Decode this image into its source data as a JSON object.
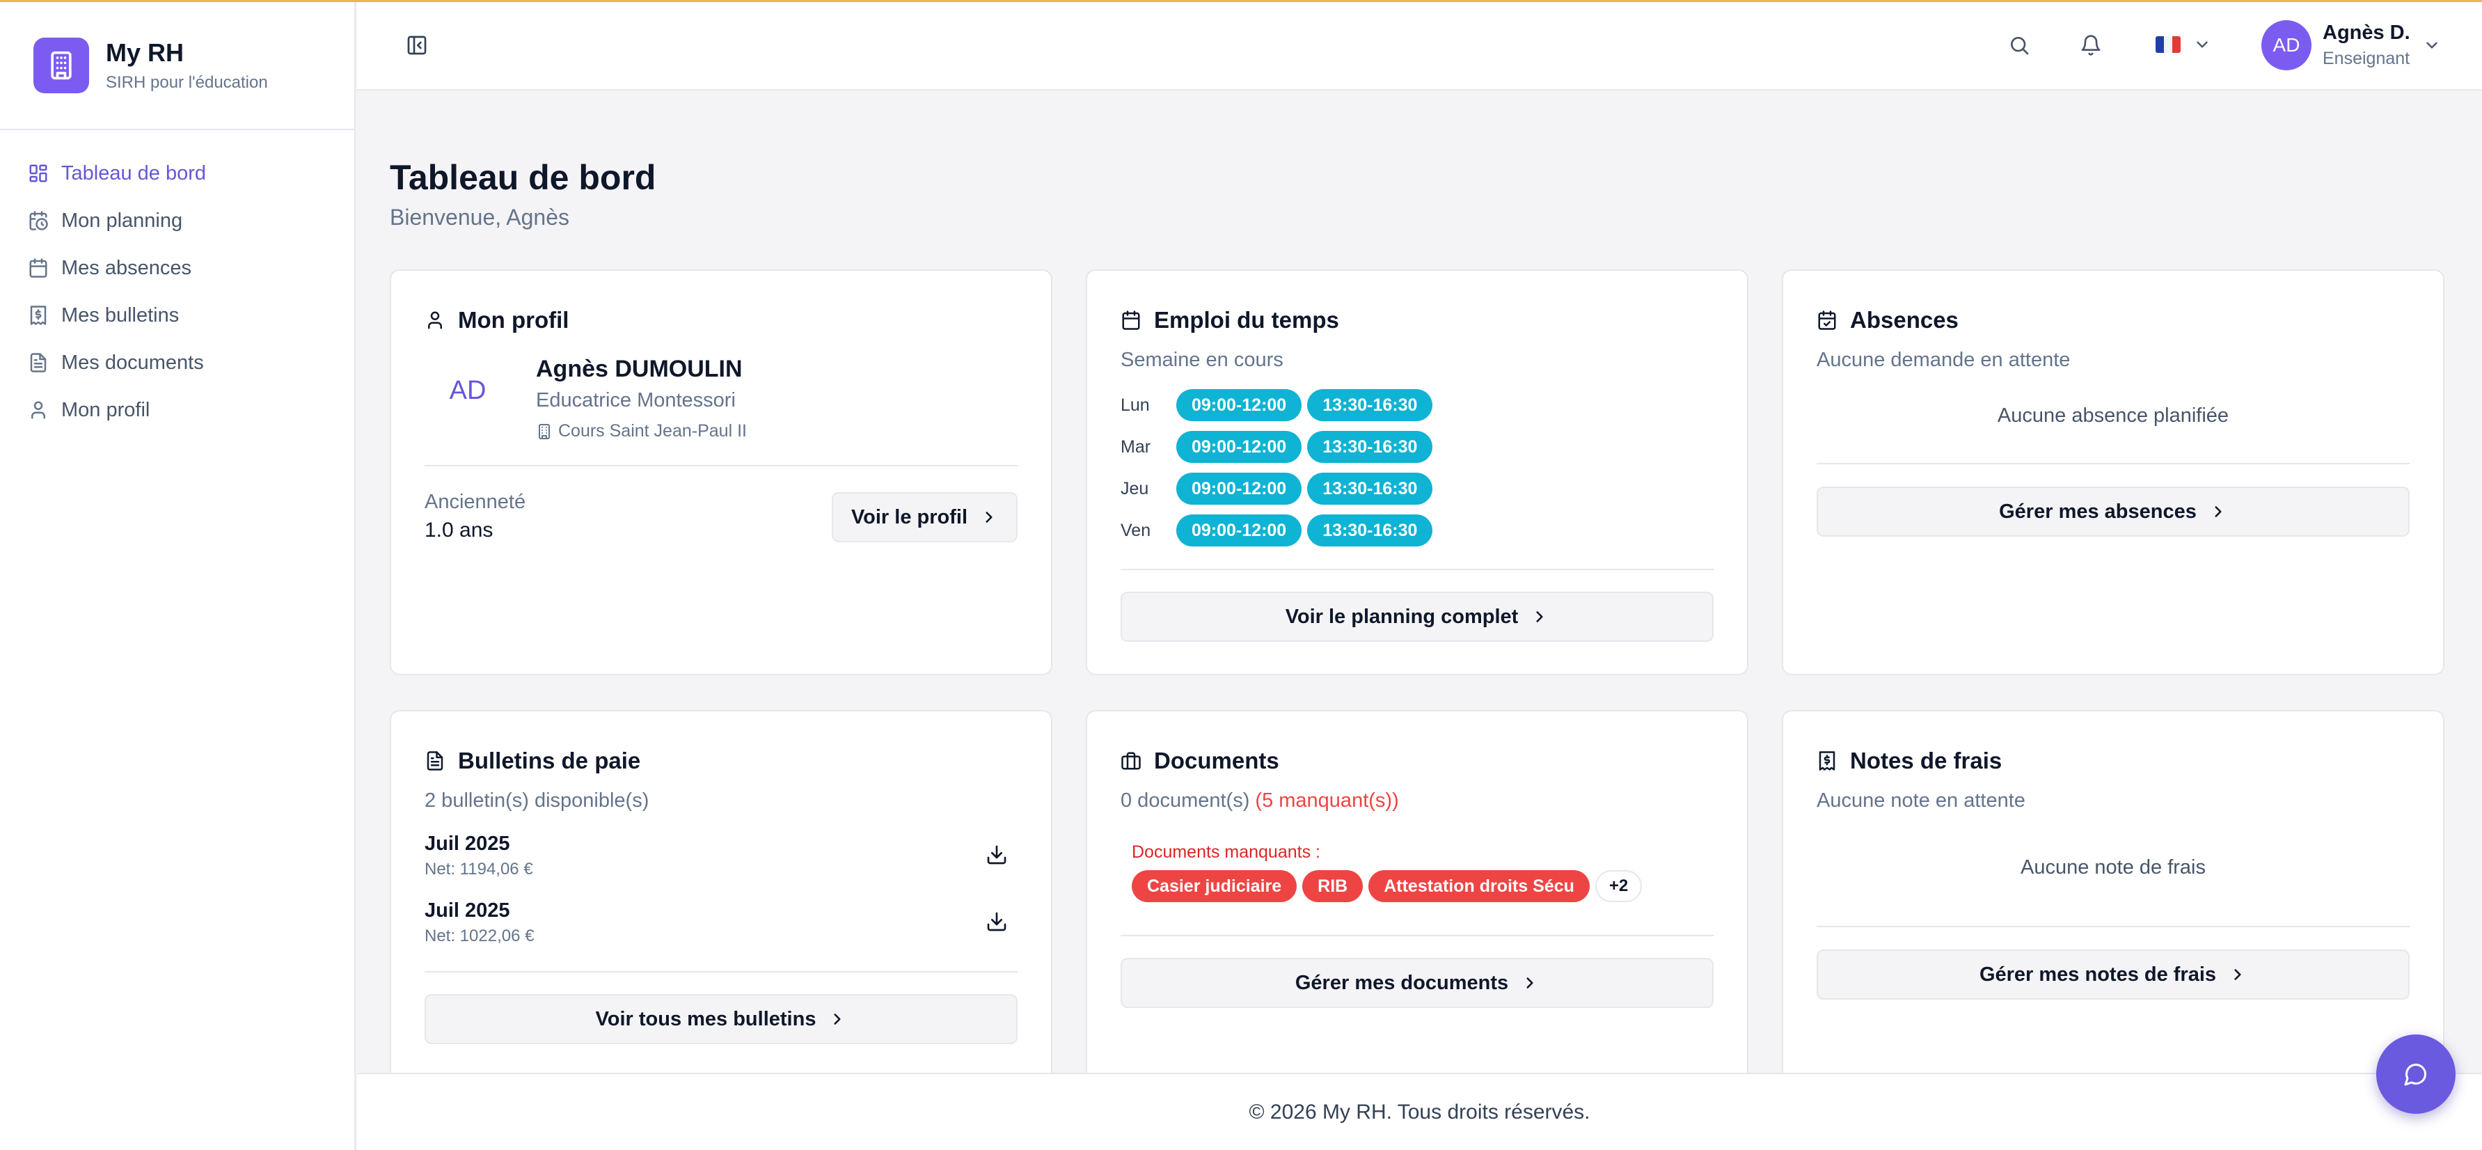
{
  "brand": {
    "title": "My RH",
    "subtitle": "SIRH pour l'éducation"
  },
  "sidebar": {
    "items": [
      {
        "label": "Tableau de bord",
        "icon": "dashboard-icon",
        "active": true
      },
      {
        "label": "Mon planning",
        "icon": "calendar-clock-icon"
      },
      {
        "label": "Mes absences",
        "icon": "calendar-icon"
      },
      {
        "label": "Mes bulletins",
        "icon": "receipt-icon"
      },
      {
        "label": "Mes documents",
        "icon": "file-icon"
      },
      {
        "label": "Mon profil",
        "icon": "user-icon"
      }
    ]
  },
  "header": {
    "user": {
      "initials": "AD",
      "name": "Agnès D.",
      "role": "Enseignant"
    }
  },
  "page": {
    "title": "Tableau de bord",
    "subtitle": "Bienvenue, Agnès"
  },
  "profile_card": {
    "title": "Mon profil",
    "initials": "AD",
    "name": "Agnès DUMOULIN",
    "job": "Educatrice Montessori",
    "school": "Cours Saint Jean-Paul II",
    "seniority_label": "Ancienneté",
    "seniority_value": "1.0 ans",
    "button": "Voir le profil"
  },
  "schedule_card": {
    "title": "Emploi du temps",
    "subtitle": "Semaine en cours",
    "days": [
      {
        "day": "Lun",
        "slots": [
          "09:00-12:00",
          "13:30-16:30"
        ]
      },
      {
        "day": "Mar",
        "slots": [
          "09:00-12:00",
          "13:30-16:30"
        ]
      },
      {
        "day": "Jeu",
        "slots": [
          "09:00-12:00",
          "13:30-16:30"
        ]
      },
      {
        "day": "Ven",
        "slots": [
          "09:00-12:00",
          "13:30-16:30"
        ]
      }
    ],
    "button": "Voir le planning complet"
  },
  "absences_card": {
    "title": "Absences",
    "subtitle": "Aucune demande en attente",
    "empty": "Aucune absence planifiée",
    "button": "Gérer mes absences"
  },
  "payslips_card": {
    "title": "Bulletins de paie",
    "subtitle": "2 bulletin(s) disponible(s)",
    "items": [
      {
        "month": "Juil 2025",
        "net": "Net: 1194,06 €"
      },
      {
        "month": "Juil 2025",
        "net": "Net: 1022,06 €"
      }
    ],
    "button": "Voir tous mes bulletins"
  },
  "documents_card": {
    "title": "Documents",
    "count": "0 document(s)",
    "missing_count": "(5 manquant(s))",
    "missing_label": "Documents manquants :",
    "missing": [
      "Casier judiciaire",
      "RIB",
      "Attestation droits Sécu"
    ],
    "more": "+2",
    "button": "Gérer mes documents"
  },
  "expenses_card": {
    "title": "Notes de frais",
    "subtitle": "Aucune note en attente",
    "empty": "Aucune note de frais",
    "button": "Gérer mes notes de frais"
  },
  "footer": {
    "text": "© 2026 My RH. Tous droits réservés."
  },
  "colors": {
    "accent": "#7c5cf0",
    "schedule_chip": "#0fb3d3",
    "missing_badge": "#ef4444",
    "top_line": "#e9b949"
  }
}
